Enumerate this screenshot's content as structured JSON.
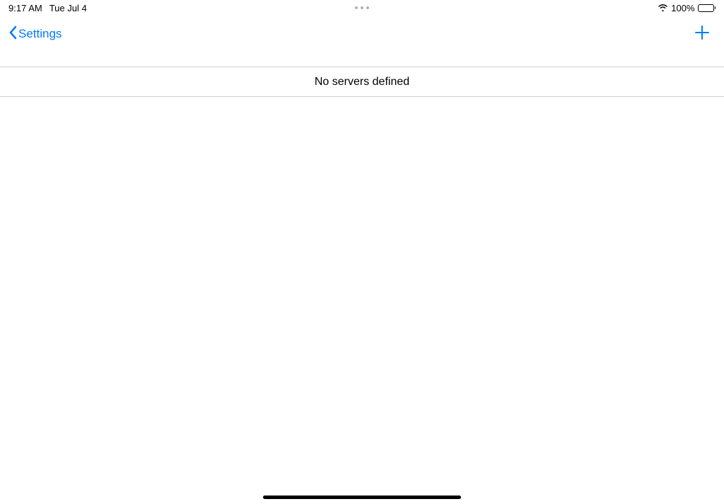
{
  "statusBar": {
    "time": "9:17 AM",
    "date": "Tue Jul 4",
    "batteryPercent": "100%"
  },
  "navBar": {
    "backLabel": "Settings"
  },
  "content": {
    "emptyMessage": "No servers defined"
  }
}
